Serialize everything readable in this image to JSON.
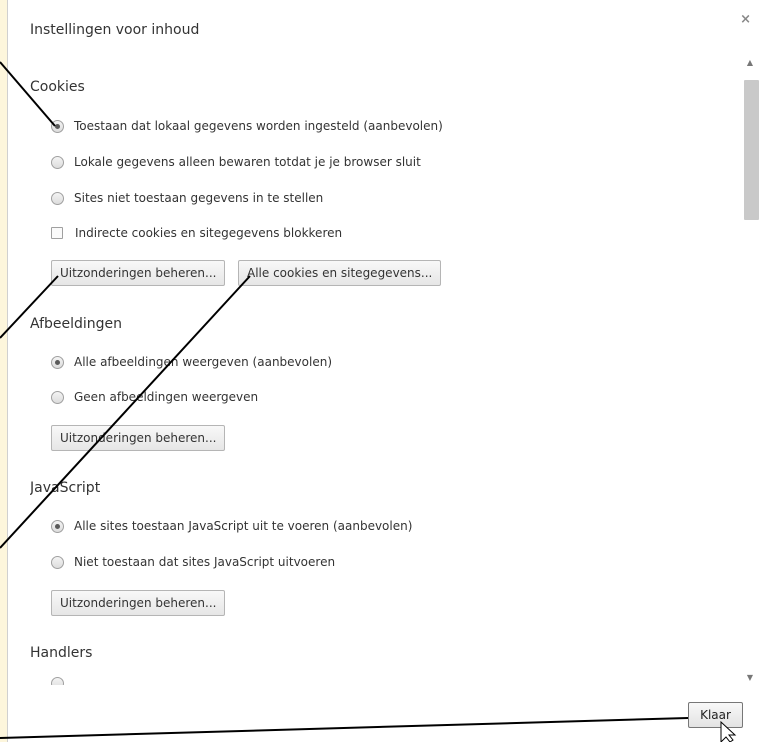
{
  "dialog": {
    "title": "Instellingen voor inhoud",
    "close_icon": "×"
  },
  "cookies": {
    "heading": "Cookies",
    "options": [
      {
        "label": "Toestaan dat lokaal gegevens worden ingesteld (aanbevolen)",
        "selected": true
      },
      {
        "label": "Lokale gegevens alleen bewaren totdat je je browser sluit",
        "selected": false
      },
      {
        "label": "Sites niet toestaan gegevens in te stellen",
        "selected": false
      }
    ],
    "checkbox_label": "Indirecte cookies en sitegegevens blokkeren",
    "exceptions_button": "Uitzonderingen beheren...",
    "all_cookies_button": "Alle cookies en sitegegevens..."
  },
  "images": {
    "heading": "Afbeeldingen",
    "options": [
      {
        "label": "Alle afbeeldingen weergeven (aanbevolen)",
        "selected": true
      },
      {
        "label": "Geen afbeeldingen weergeven",
        "selected": false
      }
    ],
    "exceptions_button": "Uitzonderingen beheren..."
  },
  "javascript": {
    "heading": "JavaScript",
    "options": [
      {
        "label": "Alle sites toestaan JavaScript uit te voeren (aanbevolen)",
        "selected": true
      },
      {
        "label": "Niet toestaan dat sites JavaScript uitvoeren",
        "selected": false
      }
    ],
    "exceptions_button": "Uitzonderingen beheren..."
  },
  "handlers": {
    "heading": "Handlers"
  },
  "footer": {
    "done_button": "Klaar"
  },
  "colors": {
    "page_background": "#fdf6dc",
    "dialog_background": "#ffffff",
    "annotation_line": "#000000"
  }
}
